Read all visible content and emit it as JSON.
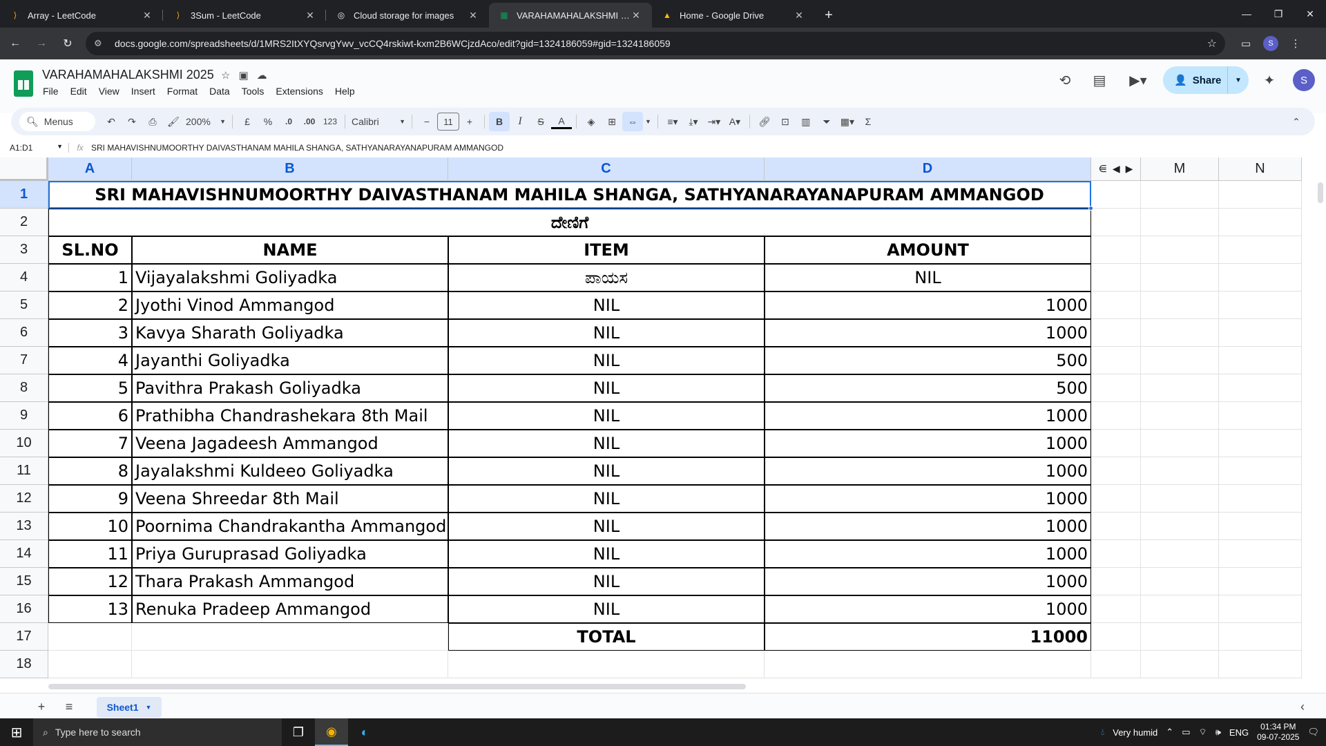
{
  "browser": {
    "tabs": [
      {
        "title": "Array - LeetCode",
        "icon": "leetcode-icon",
        "active": false
      },
      {
        "title": "3Sum - LeetCode",
        "icon": "leetcode-icon",
        "active": false
      },
      {
        "title": "Cloud storage for images",
        "icon": "cloud-icon",
        "active": false
      },
      {
        "title": "VARAHAMAHALAKSHMI 2025",
        "icon": "sheets-icon",
        "active": true
      },
      {
        "title": "Home - Google Drive",
        "icon": "drive-icon",
        "active": false
      }
    ],
    "url": "docs.google.com/spreadsheets/d/1MRS2ItXYQsrvgYwv_vcCQ4rskiwt-kxm2B6WCjzdAco/edit?gid=1324186059#gid=1324186059",
    "profile_initial": "S"
  },
  "sheets": {
    "doc_title": "VARAHAMAHALAKSHMI 2025",
    "menu": [
      "File",
      "Edit",
      "View",
      "Insert",
      "Format",
      "Data",
      "Tools",
      "Extensions",
      "Help"
    ],
    "share_label": "Share",
    "user_initial": "S",
    "toolbar": {
      "menus_label": "Menus",
      "zoom": "200%",
      "currency": "£",
      "percent": "%",
      "dec_less": ".0",
      "dec_more": ".00",
      "format_123": "123",
      "font": "Calibri",
      "font_size": "11"
    },
    "name_box": "A1:D1",
    "formula": "SRI MAHAVISHNUMOORTHY DAIVASTHANAM MAHILA SHANGA, SATHYANARAYANAPURAM AMMANGOD",
    "columns": [
      "A",
      "B",
      "C",
      "D",
      "M",
      "N"
    ],
    "rows": [
      "1",
      "2",
      "3",
      "4",
      "5",
      "6",
      "7",
      "8",
      "9",
      "10",
      "11",
      "12",
      "13",
      "14",
      "15",
      "16",
      "17",
      "18"
    ],
    "title_row": "SRI MAHAVISHNUMOORTHY DAIVASTHANAM MAHILA SHANGA, SATHYANARAYANAPURAM AMMANGOD",
    "subtitle_row": "ದೇಣಿಗೆ",
    "headers": [
      "SL.NO",
      "NAME",
      "ITEM",
      "AMOUNT"
    ],
    "records": [
      {
        "sl": "1",
        "name": "Vijayalakshmi Goliyadka",
        "item": "ಪಾಯಸ",
        "amount": "NIL"
      },
      {
        "sl": "2",
        "name": "Jyothi Vinod Ammangod",
        "item": "NIL",
        "amount": "1000"
      },
      {
        "sl": "3",
        "name": "Kavya Sharath Goliyadka",
        "item": "NIL",
        "amount": "1000"
      },
      {
        "sl": "4",
        "name": "Jayanthi Goliyadka",
        "item": "NIL",
        "amount": "500"
      },
      {
        "sl": "5",
        "name": "Pavithra Prakash Goliyadka",
        "item": "NIL",
        "amount": "500"
      },
      {
        "sl": "6",
        "name": "Prathibha Chandrashekara 8th Mail",
        "item": "NIL",
        "amount": "1000"
      },
      {
        "sl": "7",
        "name": "Veena Jagadeesh Ammangod",
        "item": "NIL",
        "amount": "1000"
      },
      {
        "sl": "8",
        "name": "Jayalakshmi Kuldeeo Goliyadka",
        "item": "NIL",
        "amount": "1000"
      },
      {
        "sl": "9",
        "name": "Veena Shreedar 8th Mail",
        "item": "NIL",
        "amount": "1000"
      },
      {
        "sl": "10",
        "name": "Poornima Chandrakantha Ammangod",
        "item": "NIL",
        "amount": "1000"
      },
      {
        "sl": "11",
        "name": "Priya Guruprasad Goliyadka",
        "item": "NIL",
        "amount": "1000"
      },
      {
        "sl": "12",
        "name": "Thara Prakash Ammangod",
        "item": "NIL",
        "amount": "1000"
      },
      {
        "sl": "13",
        "name": "Renuka Pradeep Ammangod",
        "item": "NIL",
        "amount": "1000"
      }
    ],
    "total_label": "TOTAL",
    "total_value": "11000",
    "sheet_tab": "Sheet1"
  },
  "taskbar": {
    "search_placeholder": "Type here to search",
    "weather": "Very humid",
    "lang": "ENG",
    "time": "01:34 PM",
    "date": "09-07-2025"
  }
}
